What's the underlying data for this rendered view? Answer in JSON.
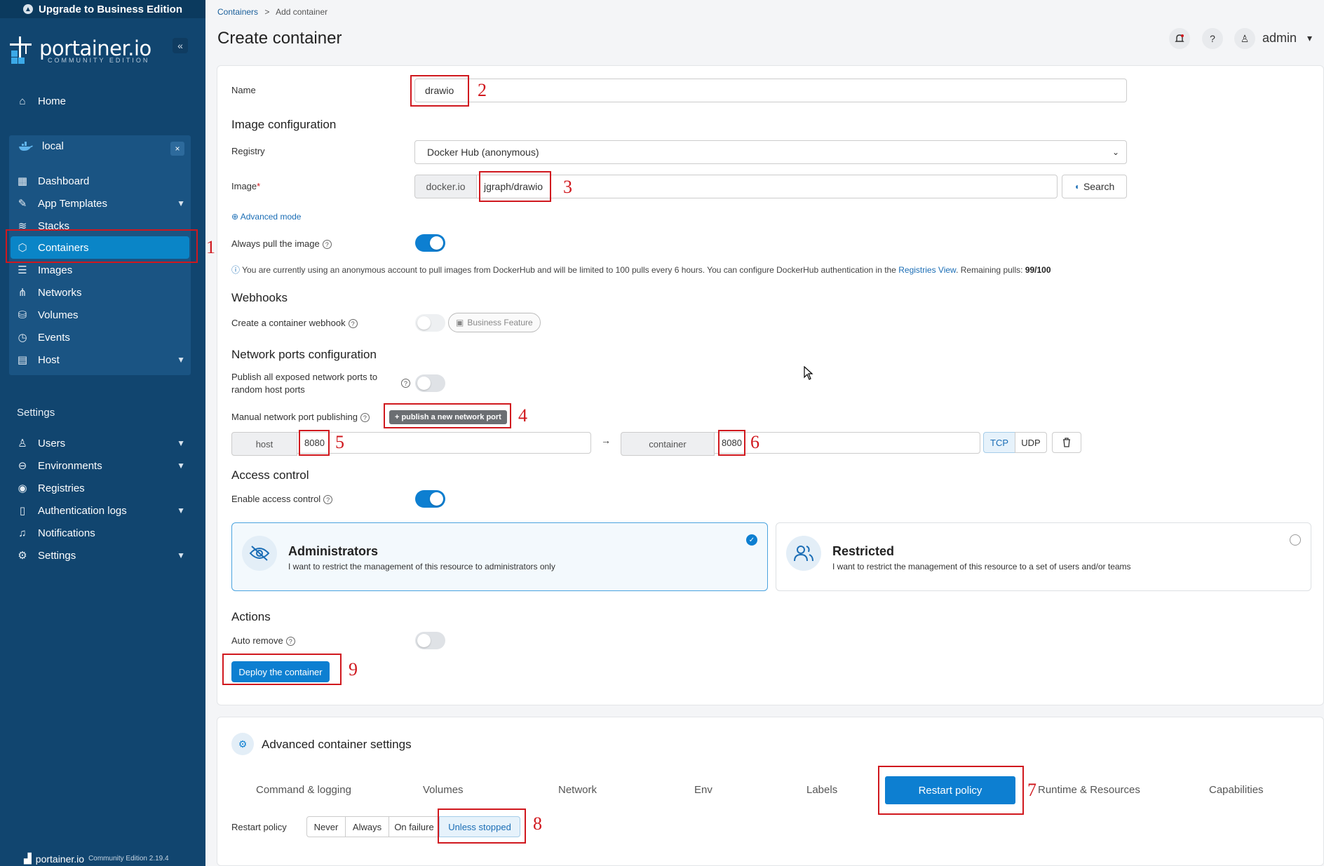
{
  "sidebar": {
    "upgrade_label": "Upgrade to Business Edition",
    "brand": "portainer.io",
    "edition": "COMMUNITY EDITION",
    "collapse": "«",
    "home": "Home",
    "environment": {
      "name": "local",
      "close": "×"
    },
    "env_items": [
      {
        "label": "Dashboard"
      },
      {
        "label": "App Templates"
      },
      {
        "label": "Stacks"
      },
      {
        "label": "Containers"
      },
      {
        "label": "Images"
      },
      {
        "label": "Networks"
      },
      {
        "label": "Volumes"
      },
      {
        "label": "Events"
      },
      {
        "label": "Host"
      }
    ],
    "settings_title": "Settings",
    "settings_items": [
      {
        "label": "Users"
      },
      {
        "label": "Environments"
      },
      {
        "label": "Registries"
      },
      {
        "label": "Authentication logs"
      },
      {
        "label": "Notifications"
      },
      {
        "label": "Settings"
      }
    ],
    "footer_brand": "portainer.io",
    "footer_version": "Community Edition 2.19.4"
  },
  "header": {
    "breadcrumb_link": "Containers",
    "breadcrumb_sep": ">",
    "breadcrumb_current": "Add container",
    "title": "Create container",
    "user": "admin"
  },
  "form": {
    "name_label": "Name",
    "name_value": "drawio",
    "image_config_title": "Image configuration",
    "registry_label": "Registry",
    "registry_value": "Docker Hub (anonymous)",
    "image_label": "Image",
    "image_required": "*",
    "image_prefix": "docker.io",
    "image_value": "jgraph/drawio",
    "search_label": "Search",
    "advanced_mode": "Advanced mode",
    "always_pull_label": "Always pull the image",
    "info_text_1": "You are currently using an anonymous account to pull images from DockerHub and will be limited to 100 pulls every 6 hours. You can configure DockerHub authentication in the",
    "info_link": "Registries View",
    "info_text_2": ". Remaining pulls:",
    "info_pulls": "99/100",
    "webhooks_title": "Webhooks",
    "webhook_label": "Create a container webhook",
    "business_feature": "Business Feature",
    "ports_title": "Network ports configuration",
    "publish_all_label_1": "Publish all exposed network ports to",
    "publish_all_label_2": "random host ports",
    "manual_label": "Manual network port publishing",
    "publish_btn": "publish a new network port",
    "host_addon": "host",
    "host_port": "8080",
    "arrow": "→",
    "container_addon": "container",
    "container_port": "8080",
    "proto_tcp": "TCP",
    "proto_udp": "UDP",
    "access_title": "Access control",
    "access_label": "Enable access control",
    "admins_title": "Administrators",
    "admins_desc": "I want to restrict the management of this resource to administrators only",
    "restricted_title": "Restricted",
    "restricted_desc": "I want to restrict the management of this resource to a set of users and/or teams",
    "actions_title": "Actions",
    "auto_remove_label": "Auto remove",
    "deploy_label": "Deploy the container"
  },
  "advanced": {
    "title": "Advanced container settings",
    "tabs": [
      {
        "label": "Command & logging"
      },
      {
        "label": "Volumes"
      },
      {
        "label": "Network"
      },
      {
        "label": "Env"
      },
      {
        "label": "Labels"
      },
      {
        "label": "Restart policy"
      },
      {
        "label": "Runtime & Resources"
      },
      {
        "label": "Capabilities"
      }
    ],
    "restart_label": "Restart policy",
    "restart_options": [
      {
        "label": "Never"
      },
      {
        "label": "Always"
      },
      {
        "label": "On failure"
      },
      {
        "label": "Unless stopped"
      }
    ]
  },
  "annotations": [
    "1",
    "2",
    "3",
    "4",
    "5",
    "6",
    "7",
    "8",
    "9"
  ],
  "colors": {
    "sidebar": "#11456f",
    "accent": "#0d7fd1",
    "annotation": "#d0181e"
  }
}
